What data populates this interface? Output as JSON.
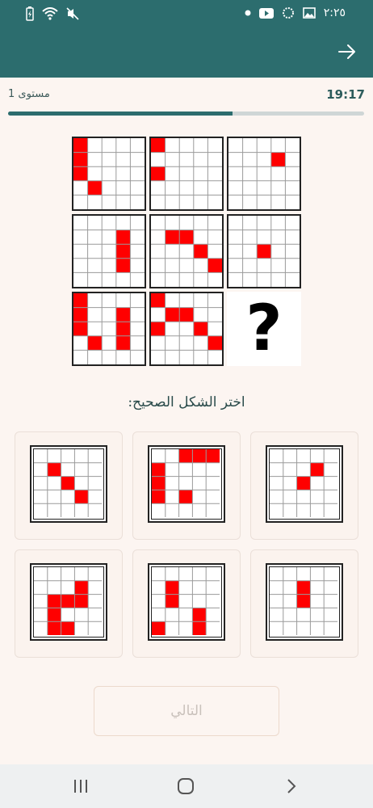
{
  "status_bar": {
    "time": "٢:٢٥",
    "left_icons": [
      "battery-icon",
      "wifi-icon",
      "mute-icon"
    ],
    "right_icons": [
      "gallery-icon",
      "status-circle-icon",
      "youtube-icon",
      "dot-icon"
    ]
  },
  "header": {
    "back_icon": "arrow-right-icon",
    "color": "#2c6d6e"
  },
  "quiz": {
    "level_label": "مستوى 1",
    "timer": "19:17",
    "progress": 0.63
  },
  "puzzle": {
    "question_mark": "?",
    "cells": [
      {
        "row": 0,
        "col": 0,
        "filled": [
          [
            0,
            0
          ],
          [
            1,
            0
          ],
          [
            2,
            0
          ],
          [
            3,
            1
          ]
        ]
      },
      {
        "row": 0,
        "col": 1,
        "filled": [
          [
            0,
            0
          ],
          [
            2,
            0
          ]
        ]
      },
      {
        "row": 0,
        "col": 2,
        "filled": [
          [
            1,
            3
          ]
        ]
      },
      {
        "row": 1,
        "col": 0,
        "filled": [
          [
            1,
            3
          ],
          [
            2,
            3
          ],
          [
            3,
            3
          ]
        ]
      },
      {
        "row": 1,
        "col": 1,
        "filled": [
          [
            1,
            1
          ],
          [
            1,
            2
          ],
          [
            2,
            3
          ],
          [
            3,
            4
          ]
        ]
      },
      {
        "row": 1,
        "col": 2,
        "filled": [
          [
            2,
            2
          ]
        ]
      },
      {
        "row": 2,
        "col": 0,
        "filled": [
          [
            0,
            0
          ],
          [
            1,
            0
          ],
          [
            2,
            0
          ],
          [
            3,
            1
          ],
          [
            1,
            3
          ],
          [
            2,
            3
          ],
          [
            3,
            3
          ]
        ]
      },
      {
        "row": 2,
        "col": 1,
        "filled": [
          [
            0,
            0
          ],
          [
            1,
            1
          ],
          [
            1,
            2
          ],
          [
            2,
            0
          ],
          [
            2,
            3
          ],
          [
            3,
            4
          ]
        ]
      }
    ]
  },
  "prompt": "اختر الشكل الصحيح:",
  "options": [
    {
      "filled": [
        [
          1,
          1
        ],
        [
          2,
          2
        ],
        [
          3,
          3
        ]
      ]
    },
    {
      "filled": [
        [
          0,
          2
        ],
        [
          0,
          3
        ],
        [
          0,
          4
        ],
        [
          1,
          0
        ],
        [
          2,
          0
        ],
        [
          3,
          0
        ],
        [
          3,
          2
        ]
      ]
    },
    {
      "filled": [
        [
          1,
          3
        ],
        [
          2,
          2
        ]
      ]
    },
    {
      "filled": [
        [
          1,
          3
        ],
        [
          2,
          1
        ],
        [
          2,
          2
        ],
        [
          2,
          3
        ],
        [
          3,
          1
        ],
        [
          4,
          1
        ],
        [
          4,
          2
        ]
      ]
    },
    {
      "filled": [
        [
          1,
          1
        ],
        [
          2,
          1
        ],
        [
          3,
          3
        ],
        [
          4,
          0
        ],
        [
          4,
          3
        ]
      ]
    },
    {
      "filled": [
        [
          1,
          2
        ],
        [
          2,
          2
        ]
      ]
    }
  ],
  "next_button": {
    "label": "التالي"
  },
  "nav": {
    "icons": [
      "recent-apps-icon",
      "home-icon",
      "back-chevron-icon"
    ]
  },
  "colors": {
    "filled": "#ff0000",
    "grid_line": "#9a9a9a"
  }
}
